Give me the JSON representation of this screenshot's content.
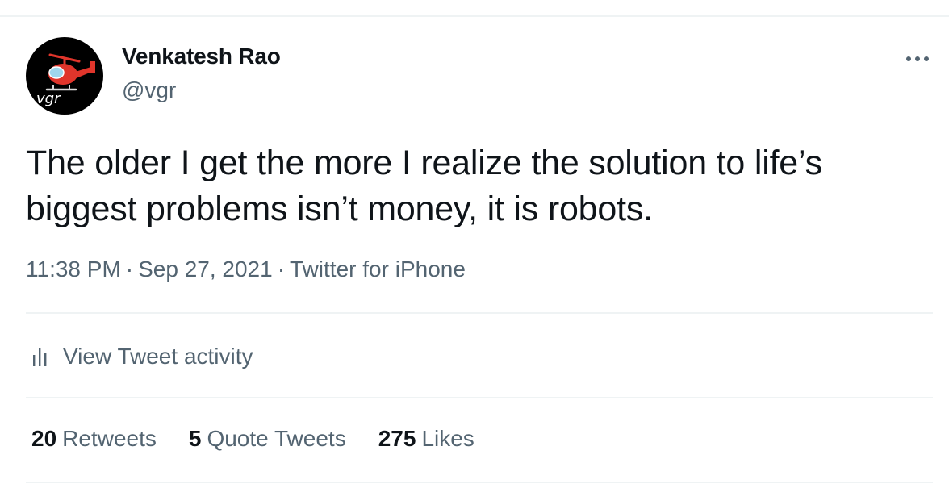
{
  "author": {
    "display_name": "Venkatesh Rao",
    "handle": "@vgr",
    "avatar_icon": "helicopter-icon",
    "avatar_text": "vgr"
  },
  "tweet": {
    "text_line_1": "The older I get the more I realize the solution to life’s",
    "text_line_2": "biggest problems isn’t money, it is robots.",
    "time": "11:38 PM",
    "date": "Sep 27, 2021",
    "source": "Twitter for iPhone",
    "separator": "·"
  },
  "activity": {
    "icon": "bar-chart-icon",
    "label": "View Tweet activity"
  },
  "stats": {
    "retweets_count": "20",
    "retweets_label": "Retweets",
    "quotes_count": "5",
    "quotes_label": "Quote Tweets",
    "likes_count": "275",
    "likes_label": "Likes"
  },
  "menu": {
    "more_icon": "more-horizontal-icon"
  },
  "colors": {
    "text_primary": "#0f1419",
    "text_secondary": "#536471",
    "divider": "#eff3f4",
    "avatar_background": "#000000",
    "helicopter_red": "#e0352b"
  }
}
